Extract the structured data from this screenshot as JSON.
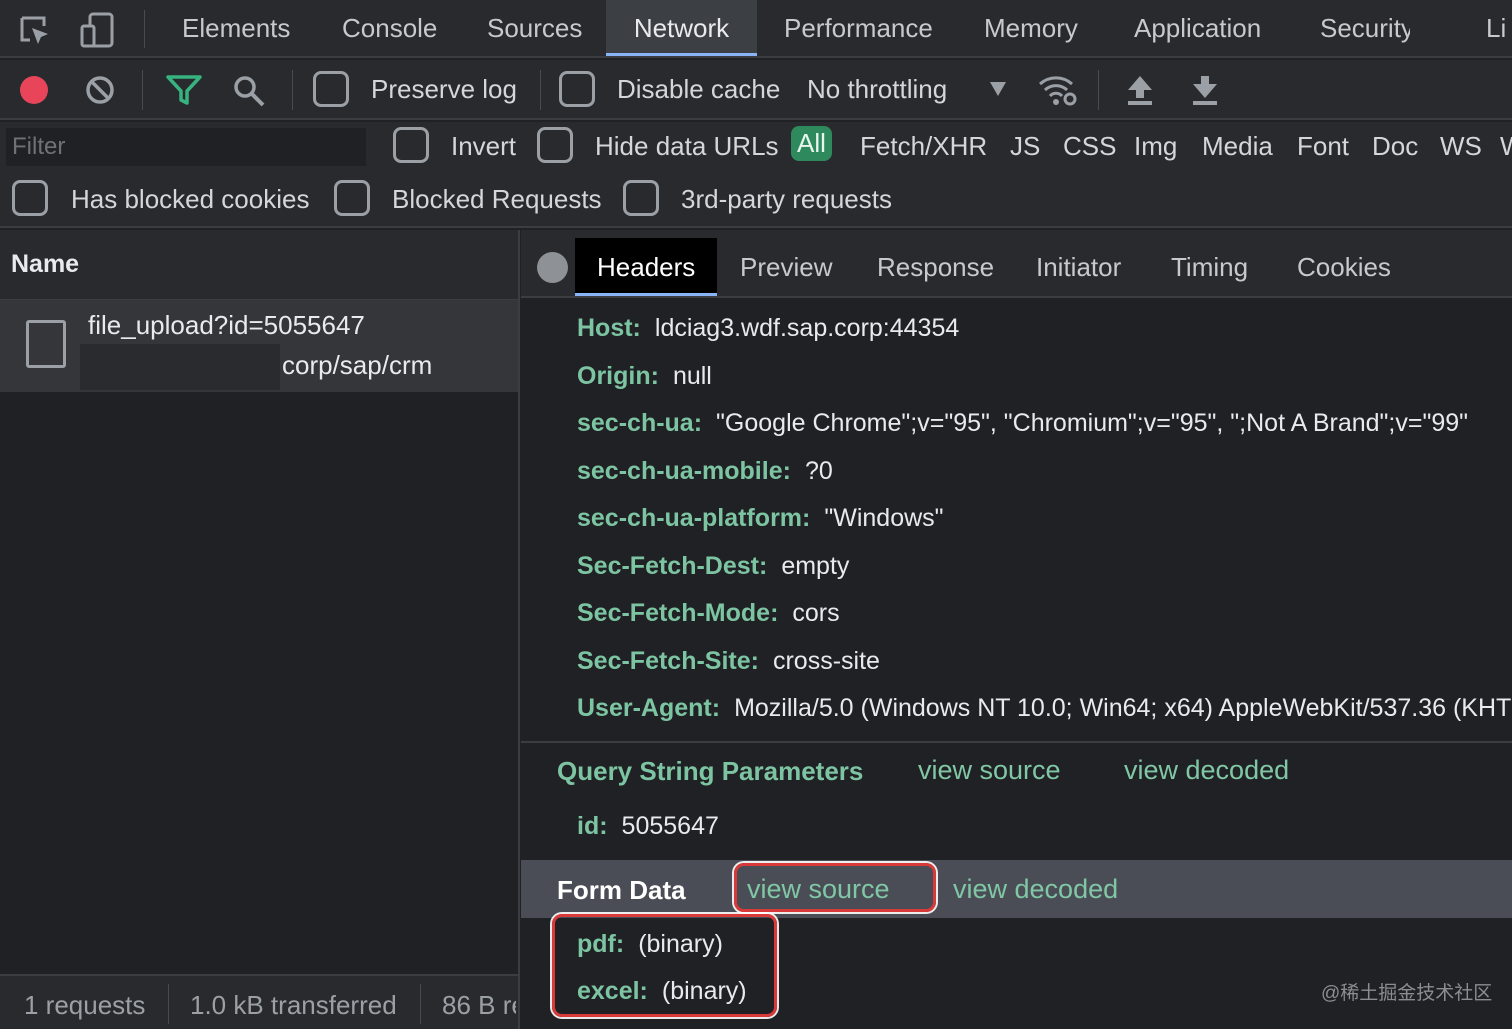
{
  "tabs": [
    "Elements",
    "Console",
    "Sources",
    "Network",
    "Performance",
    "Memory",
    "Application",
    "Security",
    "Li"
  ],
  "active_tab": "Network",
  "toolbar": {
    "preserve_log": "Preserve log",
    "disable_cache": "Disable cache",
    "throttling": "No throttling"
  },
  "filter": {
    "placeholder": "Filter",
    "invert": "Invert",
    "hide_data_urls": "Hide data URLs",
    "types": [
      "All",
      "Fetch/XHR",
      "JS",
      "CSS",
      "Img",
      "Media",
      "Font",
      "Doc",
      "WS",
      "W"
    ],
    "has_blocked_cookies": "Has blocked cookies",
    "blocked_requests": "Blocked Requests",
    "third_party": "3rd-party requests"
  },
  "left": {
    "name_header": "Name",
    "request": {
      "name": "file_upload?id=5055647",
      "path": "corp/sap/crm"
    },
    "status": {
      "requests": "1 requests",
      "transferred": "1.0 kB transferred",
      "resources": "86 B re"
    }
  },
  "detail_tabs": [
    "Headers",
    "Preview",
    "Response",
    "Initiator",
    "Timing",
    "Cookies"
  ],
  "headers": [
    {
      "key": "Host:",
      "value": "ldciag3.wdf.sap.corp:44354"
    },
    {
      "key": "Origin:",
      "value": "null"
    },
    {
      "key": "sec-ch-ua:",
      "value": "\"Google Chrome\";v=\"95\", \"Chromium\";v=\"95\", \";Not A Brand\";v=\"99\""
    },
    {
      "key": "sec-ch-ua-mobile:",
      "value": "?0"
    },
    {
      "key": "sec-ch-ua-platform:",
      "value": "\"Windows\""
    },
    {
      "key": "Sec-Fetch-Dest:",
      "value": "empty"
    },
    {
      "key": "Sec-Fetch-Mode:",
      "value": "cors"
    },
    {
      "key": "Sec-Fetch-Site:",
      "value": "cross-site"
    },
    {
      "key": "User-Agent:",
      "value": "Mozilla/5.0 (Windows NT 10.0; Win64; x64) AppleWebKit/537.36 (KHTML"
    }
  ],
  "query": {
    "title": "Query String Parameters",
    "view_source": "view source",
    "view_decoded": "view decoded",
    "params": [
      {
        "key": "id:",
        "value": "5055647"
      }
    ]
  },
  "form": {
    "title": "Form Data",
    "view_source": "view source",
    "view_decoded": "view decoded",
    "params": [
      {
        "key": "pdf:",
        "value": "(binary)"
      },
      {
        "key": "excel:",
        "value": "(binary)"
      }
    ]
  },
  "watermark": "@稀土掘金技术社区",
  "colors": {
    "record": "#e8455a",
    "accent": "#7cc4a2",
    "highlight_box": "#d83a3a",
    "chip_all": "#2e8a5c"
  },
  "icons": [
    "inspect-element-icon",
    "device-toolbar-icon",
    "record-icon",
    "clear-icon",
    "filter-icon",
    "search-icon",
    "dropdown-arrow-icon",
    "network-conditions-icon",
    "import-har-icon",
    "export-har-icon",
    "details-close-icon"
  ]
}
